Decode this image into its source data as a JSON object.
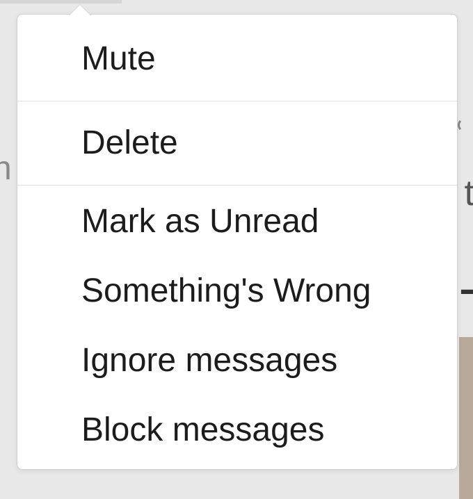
{
  "menu": {
    "items": [
      {
        "label": "Mute"
      },
      {
        "label": "Delete"
      },
      {
        "label": "Mark as Unread"
      },
      {
        "label": "Something's Wrong"
      },
      {
        "label": "Ignore messages"
      },
      {
        "label": "Block messages"
      }
    ]
  }
}
